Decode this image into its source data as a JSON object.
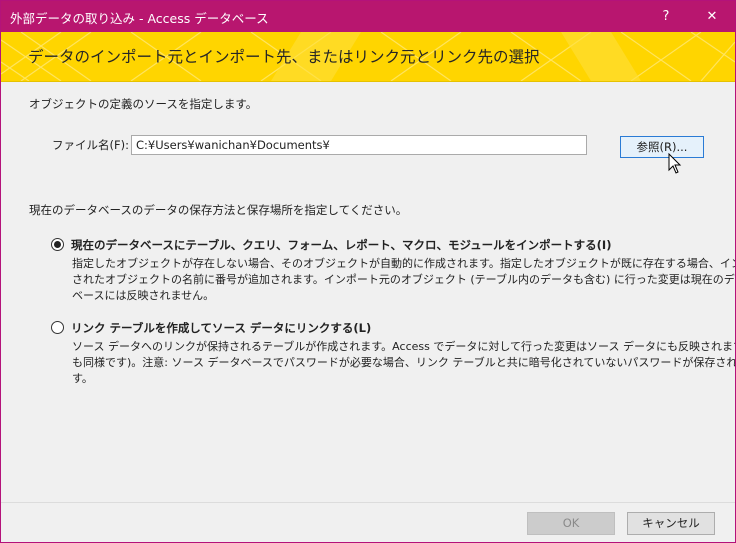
{
  "window": {
    "title": "外部データの取り込み - Access データベース",
    "help_glyph": "?",
    "close_glyph": "✕"
  },
  "banner": {
    "heading": "データのインポート元とインポート先、またはリンク元とリンク先の選択",
    "color": "#ffd500"
  },
  "source": {
    "instruction": "オブジェクトの定義のソースを指定します。",
    "file_label": "ファイル名(F):",
    "file_value": "C:¥Users¥wanichan¥Documents¥",
    "browse_label": "参照(R)..."
  },
  "storage": {
    "instruction": "現在のデータベースのデータの保存方法と保存場所を指定してください。",
    "options": [
      {
        "label": "現在のデータベースにテーブル、クエリ、フォーム、レポート、マクロ、モジュールをインポートする(I)",
        "selected": true,
        "desc": [
          "指定したオブジェクトが存在しない場合、そのオブジェクトが自動的に作成されます。指定したオブジェクトが既に存在する場合、インポート",
          "されたオブジェクトの名前に番号が追加されます。インポート元のオブジェクト (テーブル内のデータも含む) に行った変更は現在のデータ",
          "ベースには反映されません。"
        ]
      },
      {
        "label": "リンク テーブルを作成してソース データにリンクする(L)",
        "selected": false,
        "desc": [
          "ソース データへのリンクが保持されるテーブルが作成されます。Access でデータに対して行った変更はソース データにも反映されます (逆",
          "も同様です)。注意: ソース データベースでパスワードが必要な場合、リンク テーブルと共に暗号化されていないパスワードが保存されま",
          "す。"
        ]
      }
    ]
  },
  "footer": {
    "ok_label": "OK",
    "cancel_label": "キャンセル"
  },
  "colors": {
    "titlebar": "#b8166f",
    "accent_border": "#2a7bd5"
  }
}
